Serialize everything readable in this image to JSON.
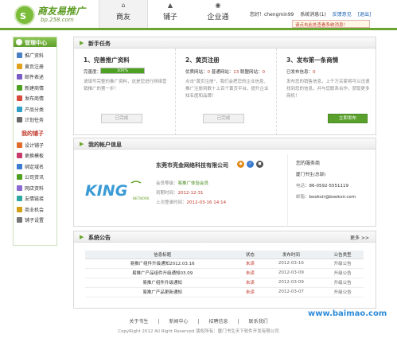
{
  "header": {
    "logo_title": "商友易推广",
    "logo_url": "bp.258.com",
    "nav": [
      {
        "label": "商友"
      },
      {
        "label": "铺子"
      },
      {
        "label": "企业通"
      }
    ],
    "greeting": "您好！chengmin99",
    "system_messages": "系统消息(1)",
    "feedback": "反馈意见",
    "logout": "[退出]",
    "notice": "请点击此处查看系统消息！"
  },
  "sidebar": {
    "title": "管理中心",
    "items": [
      {
        "label": "推广资料",
        "color": "#4a7fc1"
      },
      {
        "label": "黄页注册",
        "color": "#e0a21c"
      },
      {
        "label": "邮件表述",
        "color": "#7a5dc4"
      },
      {
        "label": "新建商情",
        "color": "#4da021"
      },
      {
        "label": "发布商情",
        "color": "#d84a3a"
      },
      {
        "label": "产品分类",
        "color": "#2f9fc6"
      },
      {
        "label": "计划任务",
        "color": "#6a6a6a"
      }
    ],
    "sub_title": "我的铺子",
    "sub_items": [
      {
        "label": "设计铺子",
        "color": "#e06d2b"
      },
      {
        "label": "更换模板",
        "color": "#c63c6b"
      },
      {
        "label": "绑定域名",
        "color": "#3b7bd0"
      },
      {
        "label": "公司资讯",
        "color": "#4da021"
      },
      {
        "label": "网店资料",
        "color": "#8a6ad0"
      },
      {
        "label": "友情链接",
        "color": "#2ea7a0"
      },
      {
        "label": "商业机会",
        "color": "#d4a017"
      },
      {
        "label": "铺子设置",
        "color": "#777777"
      }
    ]
  },
  "tasks": {
    "title": "新手任务",
    "items": [
      {
        "title": "1、完善推广资料",
        "line_label": "完善度：",
        "progress_text": "100%",
        "progress": 1.0,
        "desc": "请填写完整的推广资料，这是您进行网络营销推广的第一步！",
        "button": "已完成",
        "done": true
      },
      {
        "title": "2、黄页注册",
        "line_label": "优质网站：",
        "v1": "0",
        "mid": "普通网站：",
        "v2": "13",
        "mid2": "联盟网站：",
        "v3": "0",
        "desc": "点击\"黄页注册\"，我们会把您的企业信息、推广注册到数十上百个黄页平台，提升企业知名度和品牌！",
        "button": "已完成",
        "done": true
      },
      {
        "title": "3、发布第一条商情",
        "line_label": "已发布信息：",
        "v1": "0",
        "desc": "发布您的销售信息，上千万买家将可以迅速找到您的信息，并与您联系合作，获取更多商机！",
        "button": "立即发布",
        "done": false
      }
    ]
  },
  "account": {
    "title": "我的帐户信息",
    "logo_text": "KING",
    "logo_sub": "NETWORK",
    "company": "东莞市亮金网络科技有限公司",
    "rows": [
      {
        "label": "会员等级：",
        "value": "易推广体验会员",
        "style": "green"
      },
      {
        "label": "到期时间：",
        "value": "2012-12-31",
        "style": "red"
      },
      {
        "label": "上次登录时间：",
        "value": "2012-03-16 14:14",
        "style": "red"
      }
    ],
    "service": {
      "title": "您的服务商",
      "name": "厦门书生(总部)",
      "phone_label": "电话：",
      "phone": "86-0592-5551119",
      "email_label": "邮箱：",
      "email": "booksir@booksir.com"
    }
  },
  "announcements": {
    "title": "系统公告",
    "more": "更多 >>",
    "headers": [
      "信息标题",
      "状态",
      "发布时间",
      "公告类型"
    ],
    "rows": [
      [
        "易推广组件升级通知2012.03.16",
        "未读",
        "2012-03-16",
        "升级公告"
      ],
      [
        "易推广产品组件升级通知03.09",
        "未读",
        "2012-03-09",
        "升级公告"
      ],
      [
        "易推广组件升级通知",
        "未读",
        "2012-03-09",
        "升级公告"
      ],
      [
        "易推广产品更新通知",
        "未读",
        "2012-03-07",
        "升级公告"
      ]
    ]
  },
  "footer": {
    "links": [
      "关于书生",
      "新闻中心",
      "招聘信息",
      "联系我们"
    ],
    "copyright": "CopyRight 2012 All Right Reserved 版权所有：厦门书生天下软件开发有限公司"
  },
  "watermark": "www.baimao.com",
  "colors": {
    "brand_green": "#6aa530",
    "alert_red": "#c0392b",
    "link_blue": "#1a5fb4"
  }
}
